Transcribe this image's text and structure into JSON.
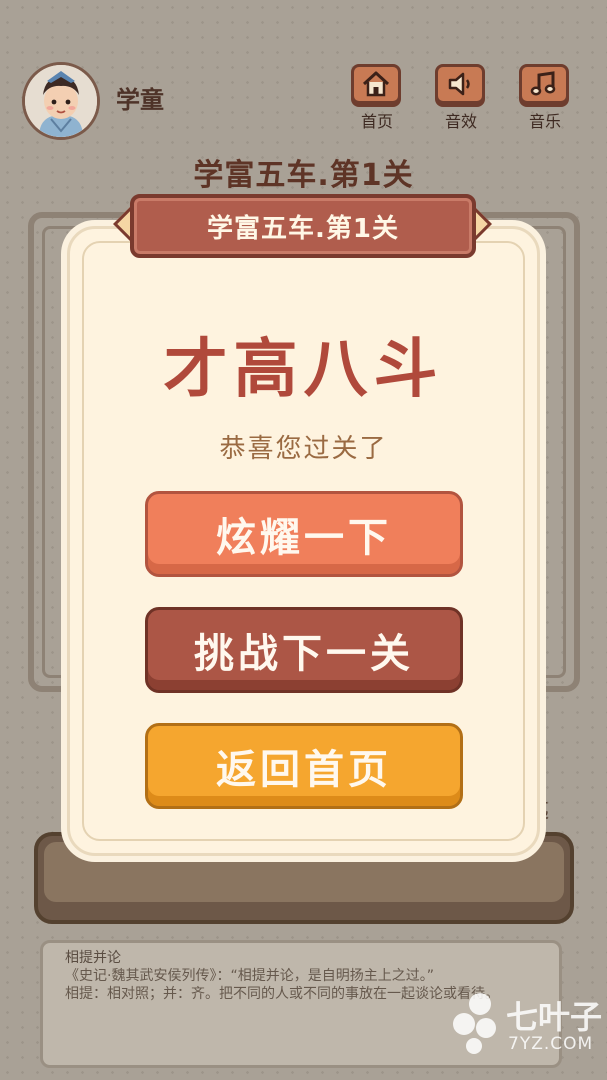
{
  "header": {
    "username": "学童",
    "buttons": [
      {
        "label": "首页",
        "icon": "home-icon"
      },
      {
        "label": "音效",
        "icon": "speaker-icon"
      },
      {
        "label": "音乐",
        "icon": "music-note-icon"
      }
    ]
  },
  "background": {
    "level_title": "学富五车.第1关",
    "note": {
      "idiom": "相提并论",
      "source": "《史记·魏其武安侯列传》：“相提并论，是自明扬主上之过。”",
      "definition": "相提：相对照；并：齐。把不同的人或不同的事放在一起谈论或看待。"
    }
  },
  "dialog": {
    "ribbon_title": "学富五车.第1关",
    "rank_title": "才高八斗",
    "message": "恭喜您过关了",
    "buttons": {
      "share": "炫耀一下",
      "next": "挑战下一关",
      "home": "返回首页"
    }
  },
  "watermark": {
    "name": "七叶子",
    "url": "7YZ.COM"
  },
  "colors": {
    "ribbon": "#b05d4d",
    "title_red": "#b0493b",
    "share_button": "#f07f5b",
    "next_button": "#ac5646",
    "home_button": "#f5a62f",
    "dialog_bg": "#fef3df"
  }
}
